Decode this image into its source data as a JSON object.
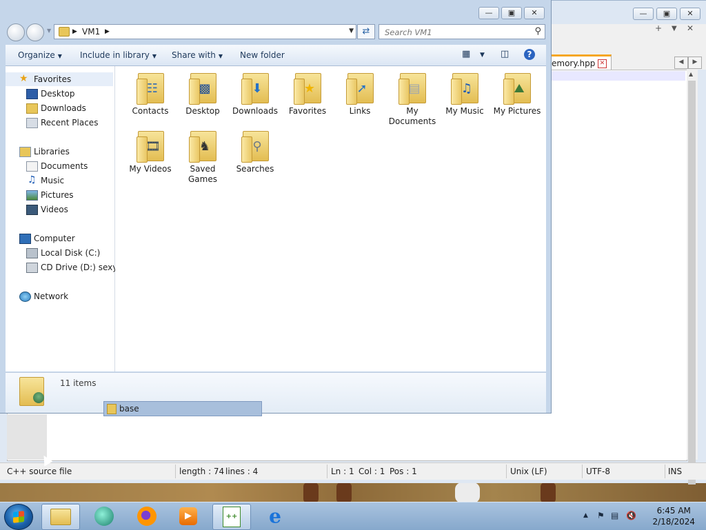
{
  "explorer": {
    "address": {
      "crumb": "VM1"
    },
    "search": {
      "placeholder": "Search VM1"
    },
    "toolbar": {
      "organize": "Organize",
      "include_in_library": "Include in library",
      "share_with": "Share with",
      "new_folder": "New folder"
    },
    "nav": {
      "favorites": "Favorites",
      "desktop": "Desktop",
      "downloads": "Downloads",
      "recent_places": "Recent Places",
      "libraries": "Libraries",
      "documents": "Documents",
      "music": "Music",
      "pictures": "Pictures",
      "videos": "Videos",
      "computer": "Computer",
      "local_disk": "Local Disk (C:)",
      "cd_drive": "CD Drive (D:) sexy",
      "network": "Network"
    },
    "items": [
      {
        "name": "Contacts",
        "icon": "contacts-icon"
      },
      {
        "name": "Desktop",
        "icon": "desktop-icon"
      },
      {
        "name": "Downloads",
        "icon": "downloads-icon"
      },
      {
        "name": "Favorites",
        "icon": "favorites-icon"
      },
      {
        "name": "Links",
        "icon": "links-icon"
      },
      {
        "name": "My Documents",
        "icon": "documents-icon"
      },
      {
        "name": "My Music",
        "icon": "music-icon"
      },
      {
        "name": "My Pictures",
        "icon": "pictures-icon"
      },
      {
        "name": "My Videos",
        "icon": "videos-icon"
      },
      {
        "name": "Saved Games",
        "icon": "games-icon"
      },
      {
        "name": "Searches",
        "icon": "search-icon"
      }
    ],
    "details": {
      "count": "11 items"
    },
    "drag_item": "base"
  },
  "notepad": {
    "tab_label": "emory.hpp",
    "status": {
      "filetype": "C++ source file",
      "length": "length : 74",
      "lines": "lines : 4",
      "ln": "Ln : 1",
      "col": "Col : 1",
      "pos": "Pos : 1",
      "eol": "Unix (LF)",
      "encoding": "UTF-8",
      "mode": "INS"
    }
  },
  "taskbar": {
    "time": "6:45 AM",
    "date": "2/18/2024"
  },
  "colors": {
    "accent": "#1e395b",
    "folder": "#e3bd52",
    "tab_highlight": "#f5a623"
  }
}
